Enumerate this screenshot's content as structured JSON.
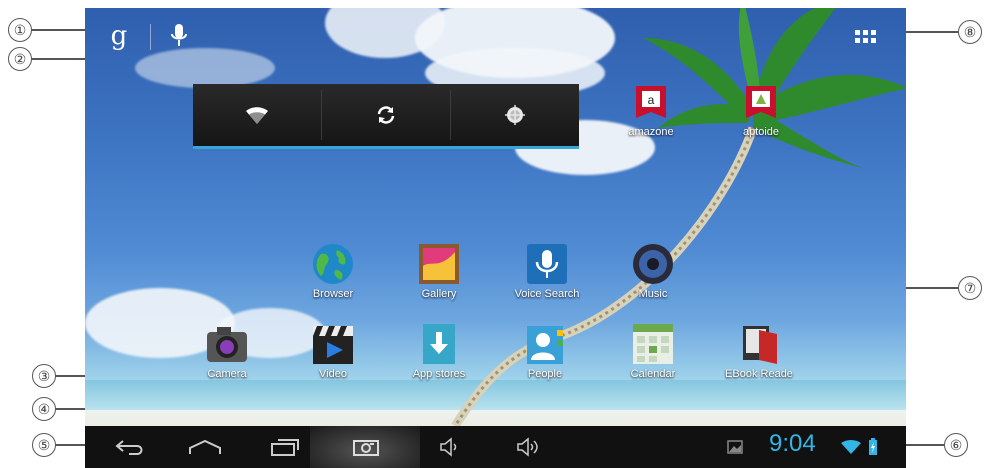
{
  "callouts": [
    "①",
    "②",
    "③",
    "④",
    "⑤",
    "⑥",
    "⑦",
    "⑧"
  ],
  "search_bar": {
    "google_glyph": "g",
    "icons": [
      "google-search-icon",
      "microphone-icon"
    ]
  },
  "quick_settings": {
    "icons": [
      "wifi-icon",
      "sync-icon",
      "brightness-icon"
    ],
    "accent": "#39a4d8"
  },
  "desktop_icons": [
    {
      "label": "amazone",
      "icon": "amazon-icon"
    },
    {
      "label": "aptoide",
      "icon": "aptoide-icon"
    }
  ],
  "apps_row1": [
    {
      "label": "Browser",
      "icon": "globe-icon"
    },
    {
      "label": "Gallery",
      "icon": "gallery-icon"
    },
    {
      "label": "Voice Search",
      "icon": "voice-search-icon"
    },
    {
      "label": "Music",
      "icon": "speaker-icon"
    }
  ],
  "apps_row2": [
    {
      "label": "Camera",
      "icon": "camera-icon"
    },
    {
      "label": "Video",
      "icon": "clapperboard-icon"
    },
    {
      "label": "App stores",
      "icon": "download-icon"
    },
    {
      "label": "People",
      "icon": "contacts-icon"
    },
    {
      "label": "Calendar",
      "icon": "calendar-icon"
    },
    {
      "label": "EBook Reade",
      "icon": "ebook-icon"
    }
  ],
  "status": {
    "time": "9:04",
    "time_color": "#33b5e5"
  },
  "nav_icons": [
    "back-icon",
    "home-icon",
    "recent-apps-icon",
    "screenshot-icon",
    "volume-down-icon",
    "volume-up-icon"
  ]
}
